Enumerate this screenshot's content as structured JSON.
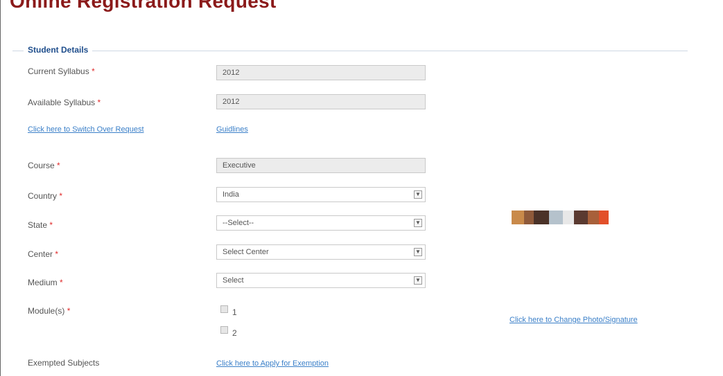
{
  "page": {
    "title": "Online Registration Request"
  },
  "fieldset": {
    "legend": "Student Details"
  },
  "required_mark": "*",
  "fields": {
    "current_syllabus": {
      "label": "Current Syllabus",
      "value": "2012"
    },
    "available_syllabus": {
      "label": "Available Syllabus",
      "value": "2012"
    },
    "course": {
      "label": "Course",
      "value": "Executive"
    },
    "country": {
      "label": "Country",
      "value": "India"
    },
    "state": {
      "label": "State",
      "value": "--Select--"
    },
    "center": {
      "label": "Center",
      "value": "Select Center"
    },
    "medium": {
      "label": "Medium",
      "value": "Select"
    },
    "modules": {
      "label": "Module(s)",
      "options": [
        "1",
        "2"
      ]
    },
    "exempted": {
      "label": "Exempted Subjects"
    }
  },
  "links": {
    "switch_over": "Click here to Switch Over Request",
    "guidelines": "Guidlines",
    "change_photo": "Click here to Change Photo/Signature",
    "exemption": "Click here to Apply for Exemption"
  },
  "colors": {
    "title": "#8b1a1a",
    "legend": "#1f4e8c",
    "link": "#3a7fc8",
    "required": "#e02b2b"
  }
}
